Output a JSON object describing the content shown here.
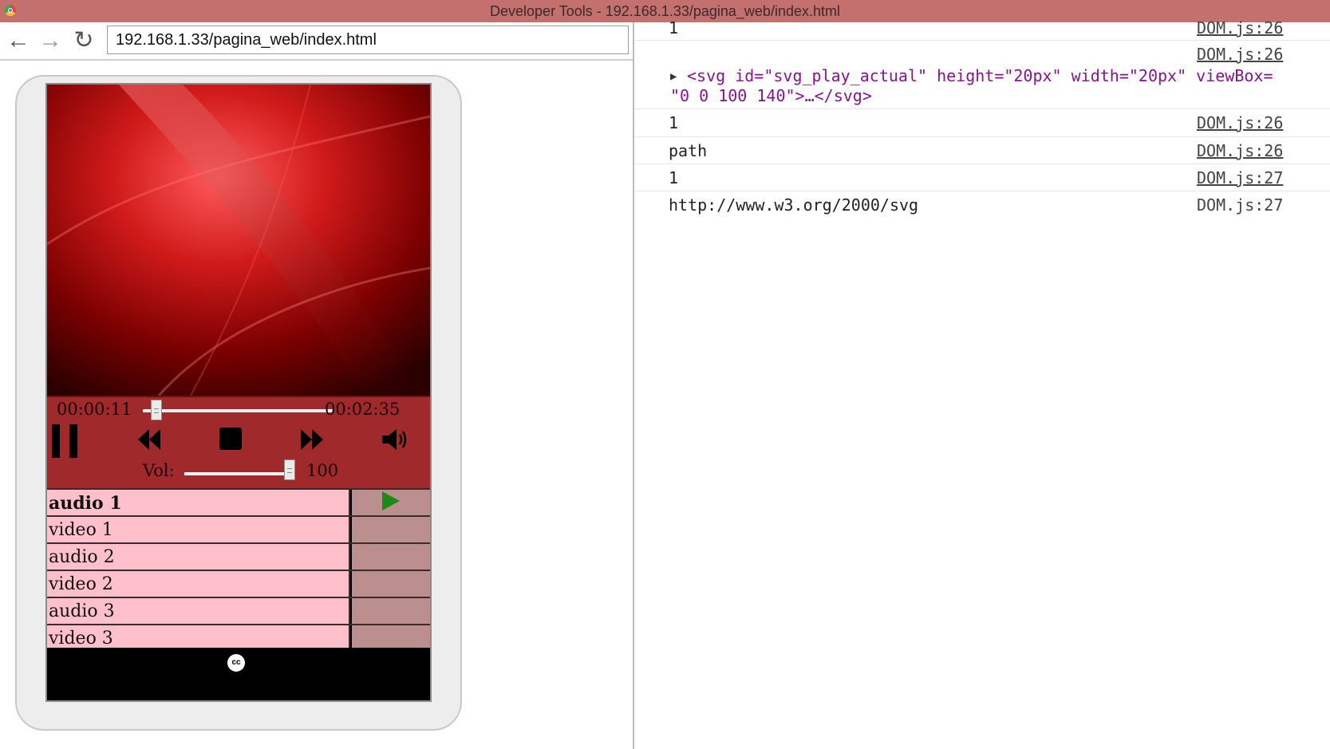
{
  "window": {
    "title": "Developer Tools - 192.168.1.33/pagina_web/index.html"
  },
  "browser": {
    "url": "192.168.1.33/pagina_web/index.html",
    "back_icon": "back-arrow-icon",
    "forward_icon": "forward-arrow-icon",
    "reload_icon": "reload-icon"
  },
  "player": {
    "current_time": "00:00:11",
    "duration": "00:02:35",
    "seek_fraction": 0.07,
    "volume_label": "Vol:",
    "volume_value": "100",
    "volume_fraction": 1.0,
    "colors": {
      "controls": "#a0292c",
      "playlist_item": "#ffc0cb",
      "playlist_status": "#bc8f8f",
      "play_indicator": "#1a8a1a"
    },
    "playlist": [
      {
        "name": "audio 1",
        "active": true
      },
      {
        "name": "video 1",
        "active": false
      },
      {
        "name": "audio 2",
        "active": false
      },
      {
        "name": "video 2",
        "active": false
      },
      {
        "name": "audio 3",
        "active": false
      },
      {
        "name": "video 3",
        "active": false
      }
    ],
    "cc_label": "cc"
  },
  "console": {
    "lines": [
      {
        "msg": "1",
        "src": "DOM.js:26"
      },
      {
        "src": "DOM.js:26",
        "svg_line1": "<svg id=\"svg_play_actual\" height=\"20px\" width=\"20px\" viewBox=",
        "svg_line2": "\"0 0 100 140\">…</svg>"
      },
      {
        "msg": "1",
        "src": "DOM.js:26"
      },
      {
        "msg": "path",
        "src": "DOM.js:26"
      },
      {
        "msg": "1",
        "src": "DOM.js:27"
      },
      {
        "msg": "http://www.w3.org/2000/svg",
        "src": "DOM.js:27"
      }
    ]
  }
}
